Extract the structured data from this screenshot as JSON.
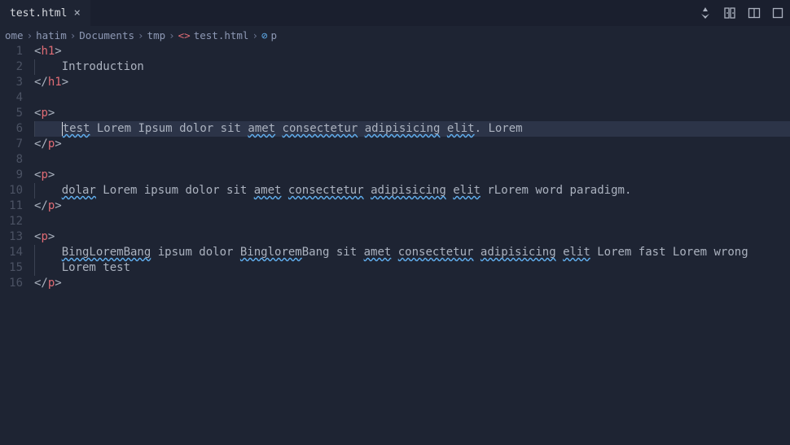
{
  "tab": {
    "name": "test.html"
  },
  "titlebar_icons": [
    "customize-icon",
    "compare-icon",
    "split-editor-icon",
    "more-icon"
  ],
  "breadcrumb": {
    "items": [
      "ome",
      "hatim",
      "Documents",
      "tmp",
      "test.html",
      "p"
    ]
  },
  "gutter": [
    "1",
    "2",
    "3",
    "4",
    "5",
    "6",
    "7",
    "8",
    "9",
    "10",
    "11",
    "12",
    "13",
    "14",
    "15",
    "16"
  ],
  "code": {
    "l1": {
      "o": "<",
      "t": "h1",
      "c": ">"
    },
    "l2": {
      "txt": "Introduction"
    },
    "l3": {
      "o": "</",
      "t": "h1",
      "c": ">"
    },
    "l5": {
      "o": "<",
      "t": "p",
      "c": ">"
    },
    "l6": {
      "w1": "test",
      "w2": "Lorem",
      "w3": "Ipsum",
      "w4": "dolor",
      "w5": "sit",
      "w6": "amet",
      "w7": "consectetur",
      "w8": "adipisicing",
      "w9": "elit",
      "p": ". ",
      "w10": "Lorem"
    },
    "l7": {
      "o": "</",
      "t": "p",
      "c": ">"
    },
    "l9": {
      "o": "<",
      "t": "p",
      "c": ">"
    },
    "l10": {
      "w1": "dolar",
      "pre": " Lorem ipsum dolor sit ",
      "w2": "amet",
      "w3": "consectetur",
      "w4": "adipisicing",
      "w5": "elit",
      "post": " rLorem word paradigm."
    },
    "l11": {
      "o": "</",
      "t": "p",
      "c": ">"
    },
    "l13": {
      "o": "<",
      "t": "p",
      "c": ">"
    },
    "l14": {
      "w1": "BingLoremBang",
      "mid1": " ipsum dolor ",
      "w2": "Binglorem",
      "mid2": "Bang sit ",
      "w3": "amet",
      "w4": "consectetur",
      "w5": "adipisicing",
      "w6": "elit",
      "post": " Lorem fast Lorem wrong"
    },
    "l15": {
      "txt": "Lorem test"
    },
    "l16": {
      "o": "</",
      "t": "p",
      "c": ">"
    }
  }
}
